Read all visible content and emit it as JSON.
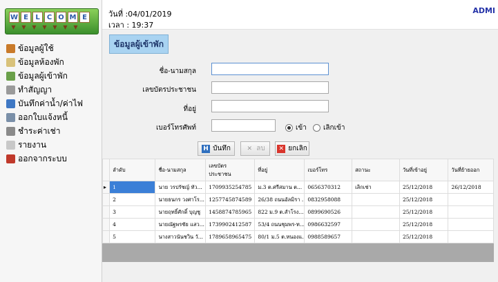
{
  "header": {
    "date_label": "วันที่ :04/01/2019",
    "time_label": "เวลา : 19:37",
    "user": "ADMI"
  },
  "logo": {
    "letters": [
      "W",
      "E",
      "L",
      "C",
      "O",
      "M",
      "E"
    ]
  },
  "sidebar": {
    "items": [
      {
        "label": "ข้อมูลผู้ใช้",
        "icon": "users-icon",
        "color": "#c97a2a"
      },
      {
        "label": "ข้อมูลห้องพัก",
        "icon": "room-icon",
        "color": "#d9c27a"
      },
      {
        "label": "ข้อมูลผู้เข้าพัก",
        "icon": "guest-icon",
        "color": "#6aa04a"
      },
      {
        "label": "ทำสัญญา",
        "icon": "contract-icon",
        "color": "#9a9a9a"
      },
      {
        "label": "บันทึกค่าน้ำ/ค่าไฟ",
        "icon": "meter-icon",
        "color": "#3f78c4"
      },
      {
        "label": "ออกใบแจ้งหนี้",
        "icon": "invoice-icon",
        "color": "#7a8fa8"
      },
      {
        "label": "ชำระค่าเช่า",
        "icon": "pay-icon",
        "color": "#8a8a8a"
      },
      {
        "label": "รายงาน",
        "icon": "report-icon",
        "color": "#c8c8c8"
      },
      {
        "label": "ออกจากระบบ",
        "icon": "logout-icon",
        "color": "#c0392b"
      }
    ]
  },
  "form": {
    "title": "ข้อมูลผู้เข้าพัก",
    "name_label": "ชื่อ-นามสกุล",
    "idcard_label": "เลขบัตรประชาชน",
    "address_label": "ที่อยู่",
    "phone_label": "เบอร์โทรศัพท์",
    "radio_in": "เข้า",
    "radio_out": "เลิกเข้า"
  },
  "buttons": {
    "save": "บันทึก",
    "delete": "ลบ",
    "cancel": "ยกเลิก"
  },
  "table": {
    "columns": [
      "ลำดับ",
      "ชื่อ-นามสกุล",
      "เลขบัตร\nประชาชน",
      "ที่อยู่",
      "เบอร์โทร",
      "สถานะ",
      "วันที่เข้าอยู่",
      "วันที่ย้ายออก"
    ],
    "rows": [
      [
        "1",
        "นาย วรปรัชญ์ ทัว...",
        "1709935254785",
        "ม.3 ต.ศรีสมาน ต...",
        "0656370312",
        "เลิกเช่า",
        "25/12/2018",
        "26/12/2018"
      ],
      [
        "2",
        "นายธนกร วงศาโร...",
        "1257745874589",
        "26/38 ถนนอัลมิรา ...",
        "0832958088",
        "",
        "25/12/2018",
        ""
      ],
      [
        "3",
        "นายฤทธิ์ศักดิ์ บุญชู",
        "1458874785965",
        "822 ม.9 ต.สำโรง...",
        "0899690526",
        "",
        "25/12/2018",
        ""
      ],
      [
        "4",
        "นายณัฐพรชัย แสว...",
        "1739902412587",
        "53/4 ถนนชุมพร-ท...",
        "0986632597",
        "",
        "25/12/2018",
        ""
      ],
      [
        "5",
        "นางสาวนันชวิน วั...",
        "1789658965475",
        "80/1 ม.5 ต.หนองแ...",
        "0988589657",
        "",
        "25/12/2018",
        ""
      ]
    ]
  }
}
